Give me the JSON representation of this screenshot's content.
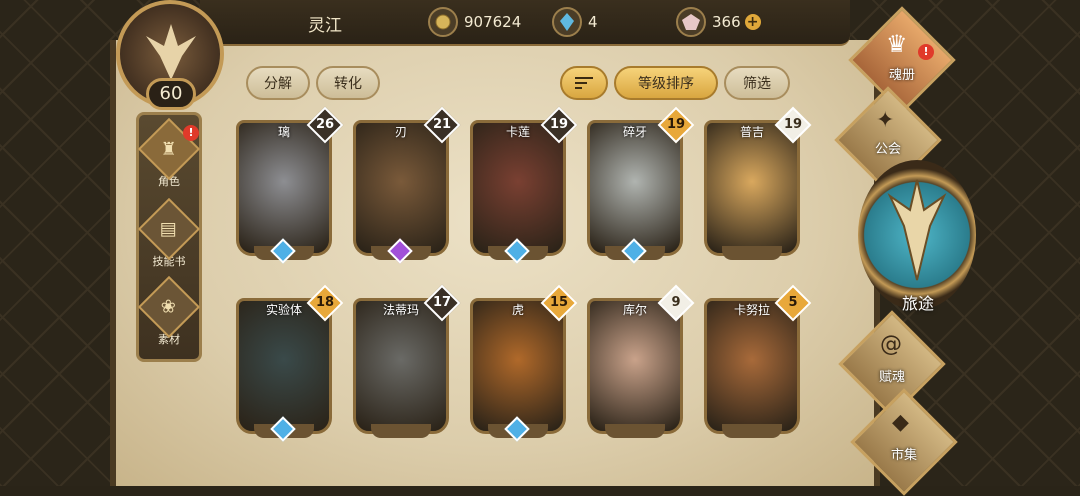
{
  "header": {
    "player_name": "灵江",
    "level": "60",
    "gold": "907624",
    "crystals": "4",
    "gems": "366",
    "gems_add": "+"
  },
  "sidebar": {
    "items": [
      {
        "label": "角色",
        "icon": "helmet-icon",
        "badge": "!"
      },
      {
        "label": "技能书",
        "icon": "book-icon"
      },
      {
        "label": "素材",
        "icon": "material-icon"
      }
    ]
  },
  "toolbar": {
    "decompose": "分解",
    "convert": "转化",
    "sort_level": "等级排序",
    "filter": "筛选"
  },
  "cards": [
    {
      "name": "璃",
      "level": "26",
      "rarity": "black",
      "gem": "blue",
      "color": "#8d8e92"
    },
    {
      "name": "刃",
      "level": "21",
      "rarity": "black",
      "gem": "purple",
      "color": "#7a5a3a"
    },
    {
      "name": "卡莲",
      "level": "19",
      "rarity": "black",
      "gem": "blue",
      "color": "#7a4032"
    },
    {
      "name": "碎牙",
      "level": "19",
      "rarity": "gold",
      "gem": "blue",
      "color": "#b0b4b0"
    },
    {
      "name": "普吉",
      "level": "19",
      "rarity": "white",
      "gem": "none",
      "color": "#d9a85e"
    },
    {
      "name": "实验体",
      "level": "18",
      "rarity": "gold",
      "gem": "blue",
      "color": "#3a4a4a"
    },
    {
      "name": "法蒂玛",
      "level": "17",
      "rarity": "black",
      "gem": "none",
      "color": "#6a6a66"
    },
    {
      "name": "虎",
      "level": "15",
      "rarity": "gold",
      "gem": "blue",
      "color": "#b0692a"
    },
    {
      "name": "库尔",
      "level": "9",
      "rarity": "white",
      "gem": "none",
      "color": "#c9a28a"
    },
    {
      "name": "卡努拉",
      "level": "5",
      "rarity": "gold",
      "gem": "none",
      "color": "#a86a3a"
    }
  ],
  "right_menu": {
    "soul_book": "魂册",
    "soul_book_badge": "!",
    "guild": "公会",
    "journey": "旅途",
    "talent": "赋魂",
    "market": "市集"
  }
}
